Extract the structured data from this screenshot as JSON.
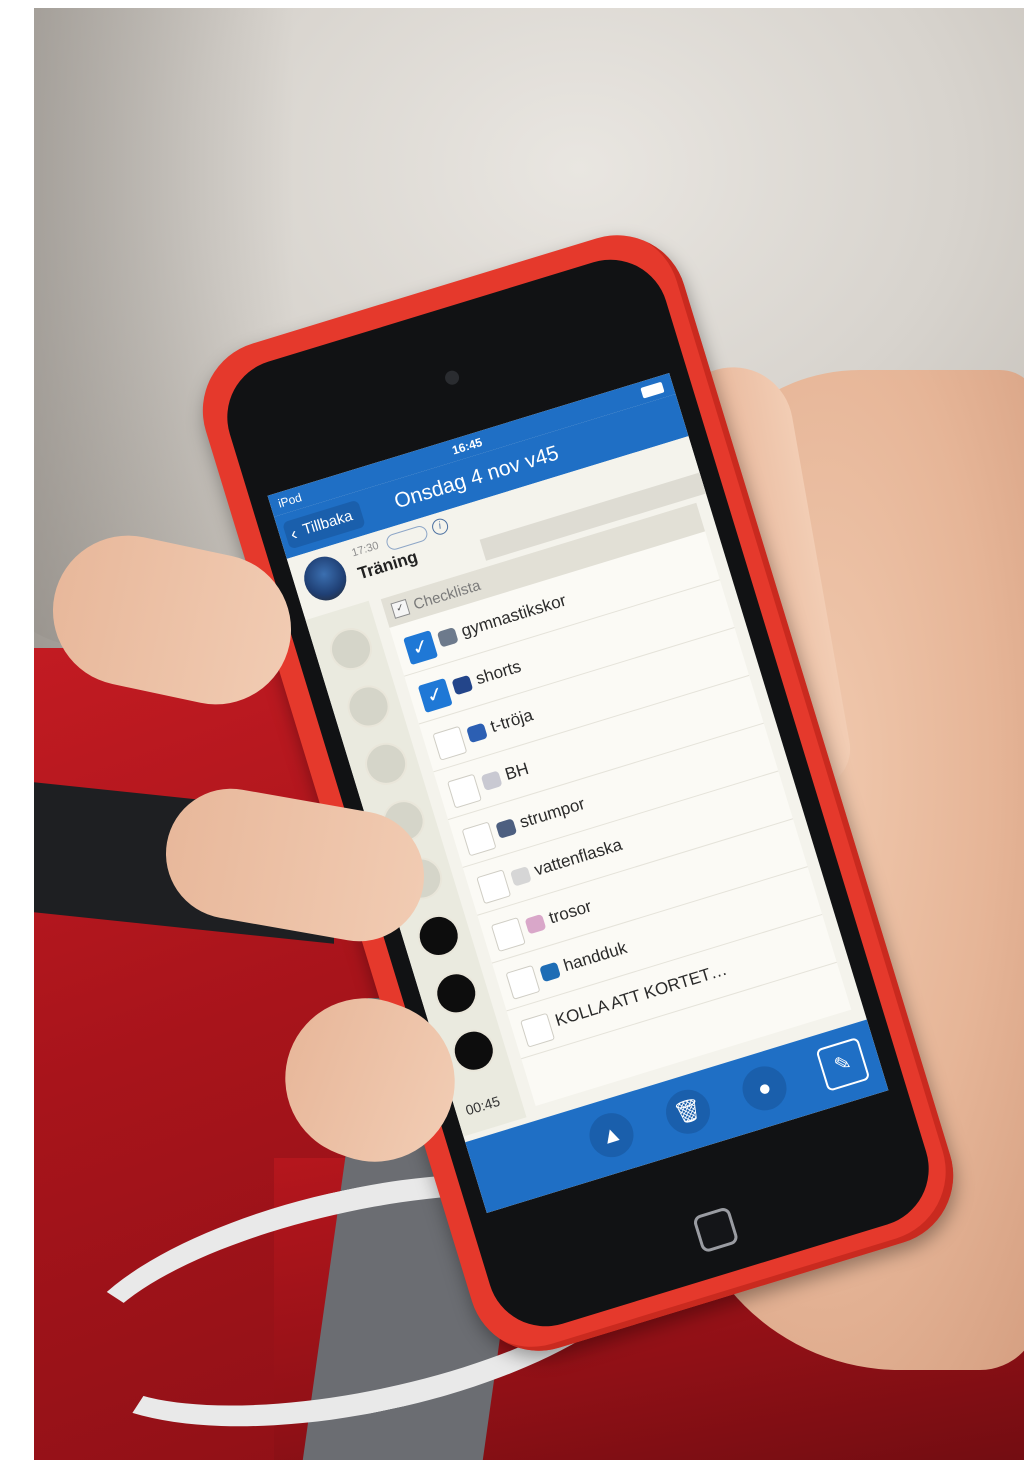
{
  "status_bar": {
    "carrier": "iPod",
    "time": "16:45"
  },
  "nav": {
    "back_label": "Tillbaka",
    "title": "Onsdag 4 nov v45"
  },
  "event": {
    "time": "17:30",
    "title": "Träning"
  },
  "checklist": {
    "header": "Checklista",
    "items": [
      {
        "label": "gymnastikskor",
        "checked": true,
        "icon": "shoe-icon"
      },
      {
        "label": "shorts",
        "checked": true,
        "icon": "shorts-icon"
      },
      {
        "label": "t-tröja",
        "checked": false,
        "icon": "tshirt-icon"
      },
      {
        "label": "BH",
        "checked": false,
        "icon": "bra-icon"
      },
      {
        "label": "strumpor",
        "checked": false,
        "icon": "socks-icon"
      },
      {
        "label": "vattenflaska",
        "checked": false,
        "icon": "bottle-icon"
      },
      {
        "label": "trosor",
        "checked": false,
        "icon": "underwear-icon"
      },
      {
        "label": "handduk",
        "checked": false,
        "icon": "towel-icon"
      },
      {
        "label": "KOLLA ATT KORTET…",
        "checked": false,
        "icon": ""
      }
    ]
  },
  "timer": {
    "label": "00:45",
    "dots_total": 8,
    "dots_dark": 3
  },
  "toolbar": {
    "icons": [
      "bell-icon",
      "trash-icon",
      "person-chat-icon",
      "edit-icon"
    ]
  },
  "colors": {
    "nav_blue": "#1f6fc5",
    "case_red": "#e5392c",
    "check_blue": "#1f78d6"
  }
}
